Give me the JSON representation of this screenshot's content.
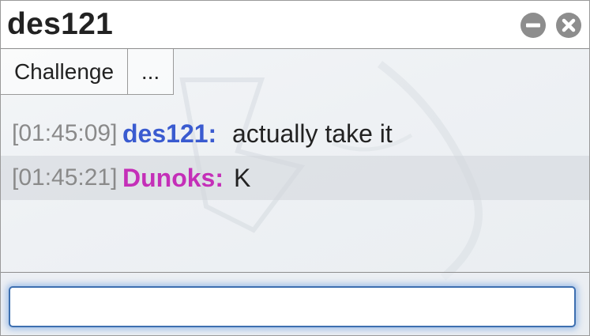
{
  "window": {
    "title": "des121",
    "minimize_icon": "minus-circle-icon",
    "close_icon": "close-circle-icon"
  },
  "tabs": [
    {
      "label": "Challenge"
    },
    {
      "label": "..."
    }
  ],
  "messages": [
    {
      "timestamp": "[01:45:09]",
      "user": "des121:",
      "text": "actually take it",
      "user_color": "#3a5bd0"
    },
    {
      "timestamp": "[01:45:21]",
      "user": "Dunoks:",
      "text": "K",
      "user_color": "#c42fb8"
    }
  ],
  "input": {
    "value": "",
    "placeholder": ""
  },
  "colors": {
    "accent_border": "#3d6fb0",
    "button_gray": "#8d8d8d"
  }
}
